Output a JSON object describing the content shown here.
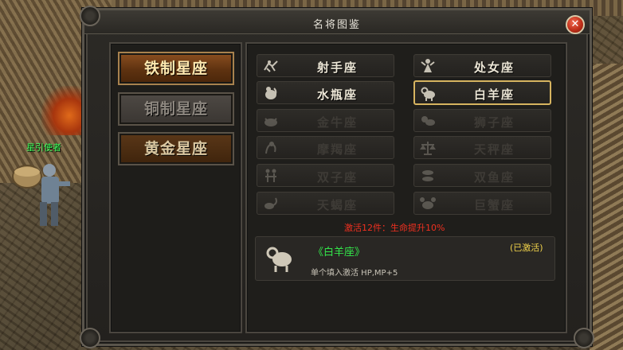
{
  "window": {
    "title": "名将图鉴",
    "close_label": "✕"
  },
  "world": {
    "npc_name": "星引使者"
  },
  "tabs": [
    {
      "label": "铁制星座",
      "state": "active"
    },
    {
      "label": "铜制星座",
      "state": "inactive"
    },
    {
      "label": "黄金星座",
      "state": "inactive"
    }
  ],
  "signs": {
    "left": [
      {
        "label": "射手座",
        "icon": "archer-icon",
        "state": "active"
      },
      {
        "label": "水瓶座",
        "icon": "water-bearer-icon",
        "state": "active"
      },
      {
        "label": "金牛座",
        "icon": "bull-icon",
        "state": "locked"
      },
      {
        "label": "摩羯座",
        "icon": "goat-icon",
        "state": "locked"
      },
      {
        "label": "双子座",
        "icon": "twins-icon",
        "state": "locked"
      },
      {
        "label": "天蝎座",
        "icon": "scorpion-icon",
        "state": "locked"
      }
    ],
    "right": [
      {
        "label": "处女座",
        "icon": "maiden-icon",
        "state": "active"
      },
      {
        "label": "白羊座",
        "icon": "ram-icon",
        "state": "selected"
      },
      {
        "label": "狮子座",
        "icon": "lion-icon",
        "state": "locked"
      },
      {
        "label": "天秤座",
        "icon": "scales-icon",
        "state": "locked"
      },
      {
        "label": "双鱼座",
        "icon": "fish-icon",
        "state": "locked"
      },
      {
        "label": "巨蟹座",
        "icon": "crab-icon",
        "state": "locked"
      }
    ]
  },
  "activation_bonus": "激活12件：生命提升10%",
  "detail": {
    "name": "《白羊座》",
    "status": "(已激活)",
    "description": "单个填入激活 HP,MP+5",
    "icon": "ram-icon"
  },
  "colors": {
    "accent_gold": "#d6b460",
    "active_tab": "#8b4f20",
    "bonus_red": "#f03020",
    "name_green": "#33e64a",
    "status_yellow": "#f0d24a"
  }
}
